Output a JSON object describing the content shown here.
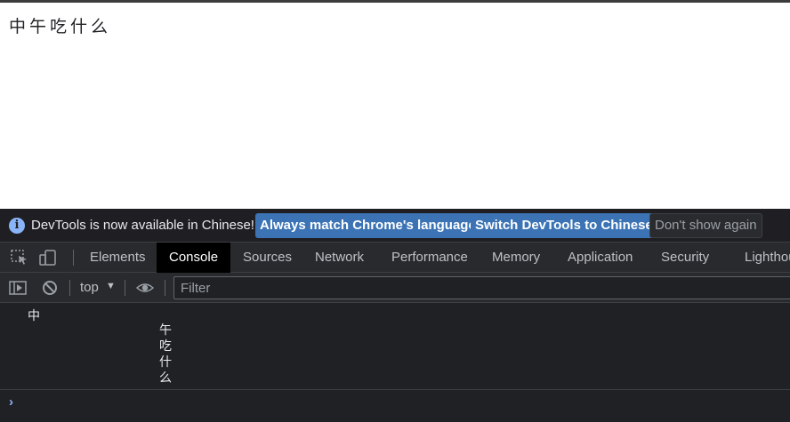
{
  "page": {
    "content_text": "中午吃什么"
  },
  "infobar": {
    "message": "DevTools is now available in Chinese!",
    "button_match": "Always match Chrome's language",
    "button_switch": "Switch DevTools to Chinese",
    "button_dismiss": "Don't show again"
  },
  "tabs": [
    {
      "label": "Elements"
    },
    {
      "label": "Console"
    },
    {
      "label": "Sources"
    },
    {
      "label": "Network"
    },
    {
      "label": "Performance"
    },
    {
      "label": "Memory"
    },
    {
      "label": "Application"
    },
    {
      "label": "Security"
    },
    {
      "label": "Lighthouse"
    }
  ],
  "active_tab": "Console",
  "toolbar": {
    "context": "top",
    "filter_placeholder": "Filter"
  },
  "console": {
    "line1": "中",
    "vertical_chars": [
      "午",
      "吃",
      "什",
      "么"
    ]
  },
  "colors": {
    "accent_button": "#3b73b5",
    "devtools_bg": "#202124",
    "prompt": "#8ab4f8"
  }
}
